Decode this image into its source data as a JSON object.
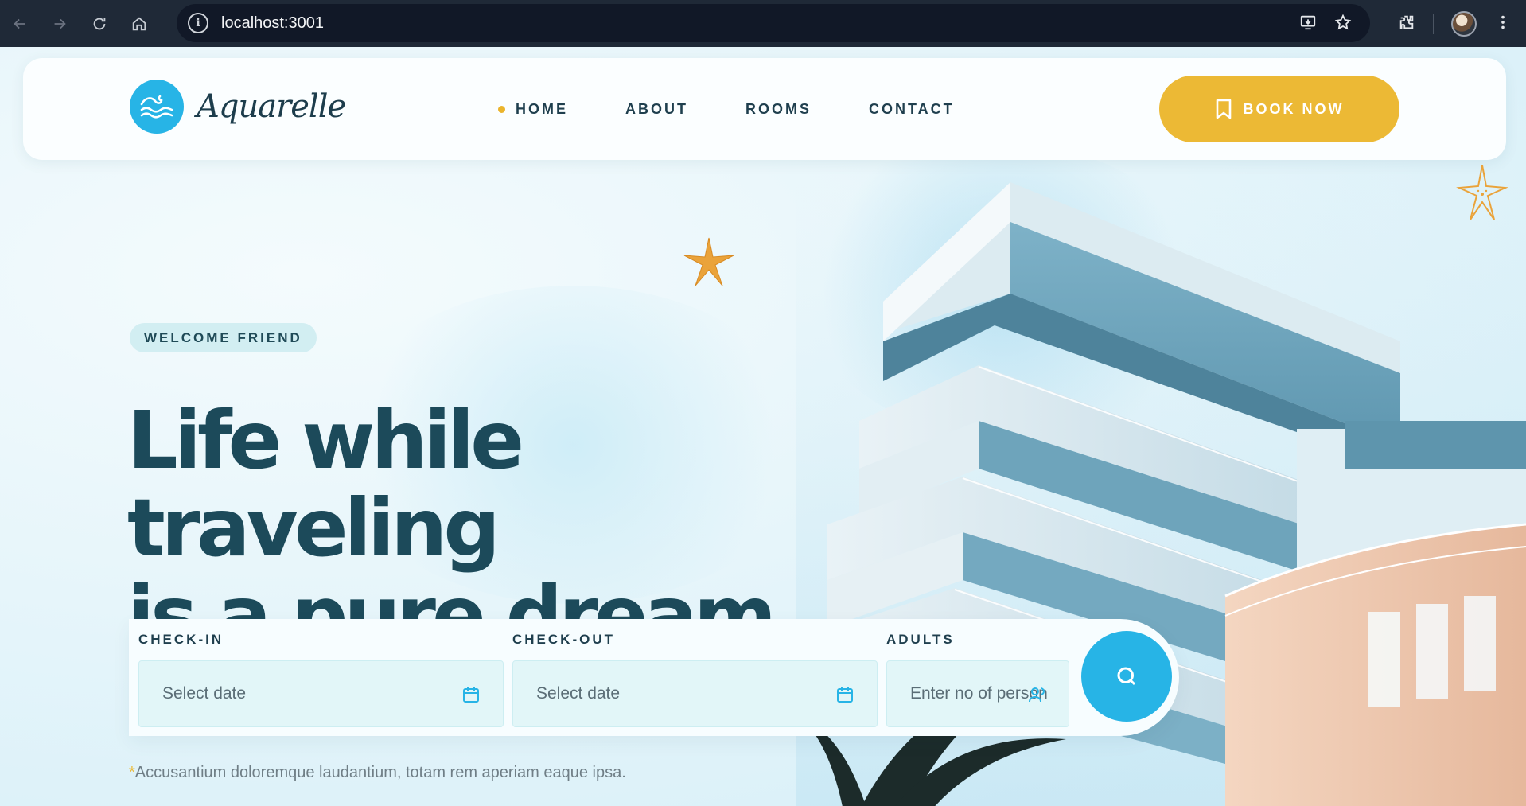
{
  "browser": {
    "url": "localhost:3001"
  },
  "header": {
    "logo_text": "Aquarelle",
    "nav": [
      {
        "label": "HOME",
        "active": true
      },
      {
        "label": "ABOUT",
        "active": false
      },
      {
        "label": "ROOMS",
        "active": false
      },
      {
        "label": "CONTACT",
        "active": false
      }
    ],
    "book_label": "BOOK NOW"
  },
  "hero": {
    "badge": "WELCOME FRIEND",
    "headline_line1": "Life while traveling",
    "headline_line2": "is a pure dream."
  },
  "booking": {
    "checkin_label": "CHECK-IN",
    "checkin_placeholder": "Select date",
    "checkout_label": "CHECK-OUT",
    "checkout_placeholder": "Select date",
    "adults_label": "ADULTS",
    "adults_placeholder": "Enter no of person"
  },
  "footnote": {
    "asterisk": "*",
    "text": "Accusantium doloremque laudantium, totam rem aperiam eaque ipsa."
  },
  "colors": {
    "accent_blue": "#27b4e6",
    "accent_yellow": "#ecb935",
    "heading": "#1c4a5a"
  }
}
